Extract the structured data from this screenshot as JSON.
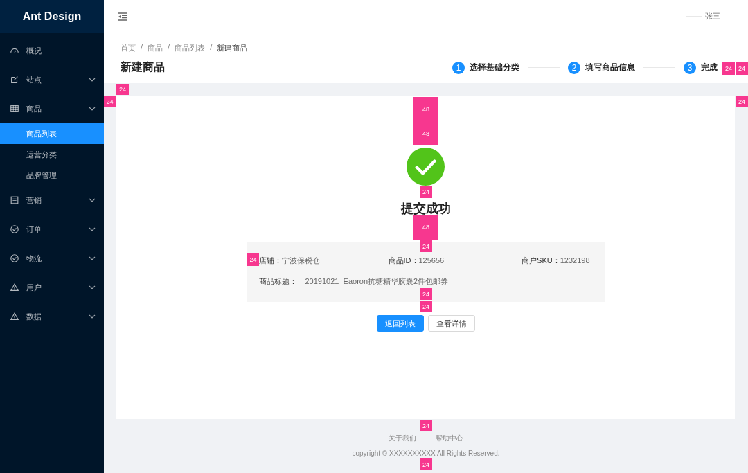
{
  "sidebar": {
    "logo": "Ant Design",
    "items": [
      {
        "label": "概况",
        "submenu": false,
        "selected": false
      },
      {
        "label": "站点",
        "submenu": true,
        "selected": false
      },
      {
        "label": "商品",
        "submenu": true,
        "selected": false,
        "children": [
          {
            "label": "商品列表",
            "selected": true
          },
          {
            "label": "运营分类",
            "selected": false
          },
          {
            "label": "品牌管理",
            "selected": false
          }
        ]
      },
      {
        "label": "营销",
        "submenu": true,
        "selected": false
      },
      {
        "label": "订单",
        "submenu": true,
        "selected": false
      },
      {
        "label": "物流",
        "submenu": true,
        "selected": false
      },
      {
        "label": "用户",
        "submenu": true,
        "selected": false
      },
      {
        "label": "数据",
        "submenu": true,
        "selected": false
      }
    ]
  },
  "header": {
    "user": "张三"
  },
  "breadcrumb": {
    "separator": "/",
    "items": [
      "首页",
      "商品",
      "商品列表",
      "新建商品"
    ]
  },
  "page_title": "新建商品",
  "steps": [
    {
      "number": "1",
      "label": "选择基础分类"
    },
    {
      "number": "2",
      "label": "填写商品信息"
    },
    {
      "number": "3",
      "label": "完成"
    }
  ],
  "result": {
    "title": "提交成功",
    "fields": [
      {
        "label": "店铺：",
        "value": "宁波保税仓"
      },
      {
        "label": "商品ID：",
        "value": "125656"
      },
      {
        "label": "商户SKU：",
        "value": "1232198"
      },
      {
        "label": "商品标题：",
        "value": "20191021  Eaoron抗糖精华胶囊2件包邮券"
      }
    ],
    "buttons": [
      {
        "label": "返回列表",
        "kind": "primary"
      },
      {
        "label": "查看详情",
        "kind": "default"
      }
    ]
  },
  "footer": {
    "links": [
      "关于我们",
      "帮助中心"
    ],
    "copyright": "copyright  © XXXXXXXXXX All Rights Reserved."
  },
  "spacing_marks": [
    "24",
    "24",
    "24",
    "24",
    "24",
    "48",
    "48",
    "24",
    "48",
    "24",
    "24",
    "24",
    "24",
    "24",
    "24"
  ]
}
